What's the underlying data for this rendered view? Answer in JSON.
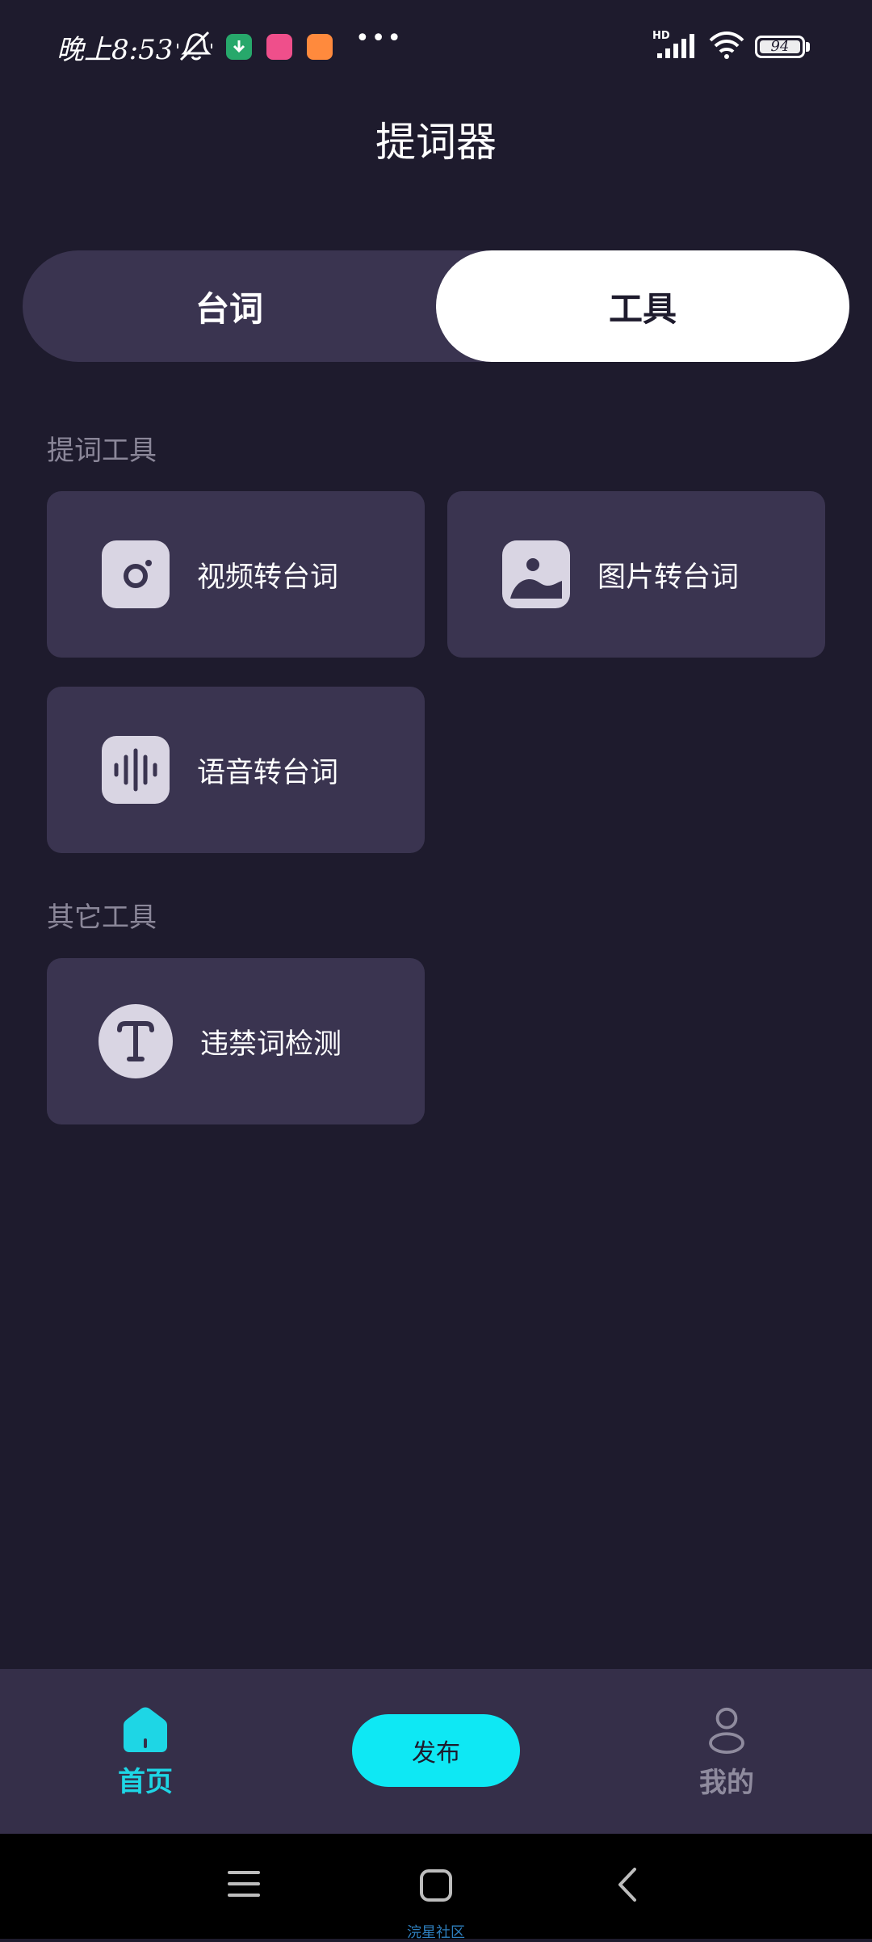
{
  "status_bar": {
    "time": "晚上8:53",
    "battery": "94"
  },
  "header": {
    "title": "提词器"
  },
  "tabs": {
    "left": "台词",
    "right": "工具"
  },
  "sections": {
    "prompt_tools": {
      "title": "提词工具",
      "items": [
        {
          "label": "视频转台词",
          "icon": "camera-icon"
        },
        {
          "label": "图片转台词",
          "icon": "image-icon"
        },
        {
          "label": "语音转台词",
          "icon": "audio-wave-icon"
        }
      ]
    },
    "other_tools": {
      "title": "其它工具",
      "items": [
        {
          "label": "违禁词检测",
          "icon": "text-t-icon"
        }
      ]
    }
  },
  "bottom_nav": {
    "home": "首页",
    "publish": "发布",
    "mine": "我的"
  },
  "watermark": "浣星社区",
  "colors": {
    "background": "#1e1b2d",
    "card": "#3a3450",
    "accent_cyan": "#0ee8f4",
    "active_nav": "#1ed6e5"
  }
}
